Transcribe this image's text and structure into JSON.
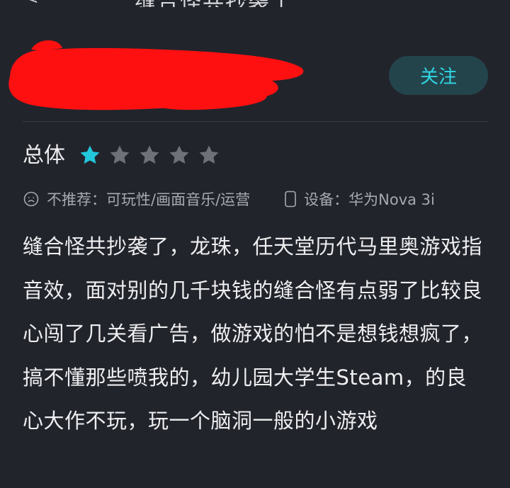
{
  "header": {
    "back_glyph": "<",
    "title_fragment": "缝合怪共抄袭了"
  },
  "user": {
    "follow_label": "关注"
  },
  "rating": {
    "label": "总体",
    "stars_filled": 1,
    "stars_total": 5,
    "star_on_color": "#22c7dc",
    "star_off_color": "#6f7179"
  },
  "meta": {
    "not_recommend_label": "不推荐：可玩性/画面音乐/运营",
    "device_label": "设备：华为Nova 3i",
    "not_recommend_icon": "sad-face-icon",
    "device_icon": "phone-icon"
  },
  "review": {
    "text": "缝合怪共抄袭了，龙珠，任天堂历代马里奥游戏指音效，面对别的几千块钱的缝合怪有点弱了比较良心闯了几关看广告，做游戏的怕不是想钱想疯了，搞不懂那些喷我的，幼儿园大学生Steam，的良心大作不玩，玩一个脑洞一般的小游戏"
  },
  "colors": {
    "background": "#22242c",
    "accent": "#2fd6e4",
    "follow_bg": "#24444c",
    "redaction": "#ff1010"
  }
}
